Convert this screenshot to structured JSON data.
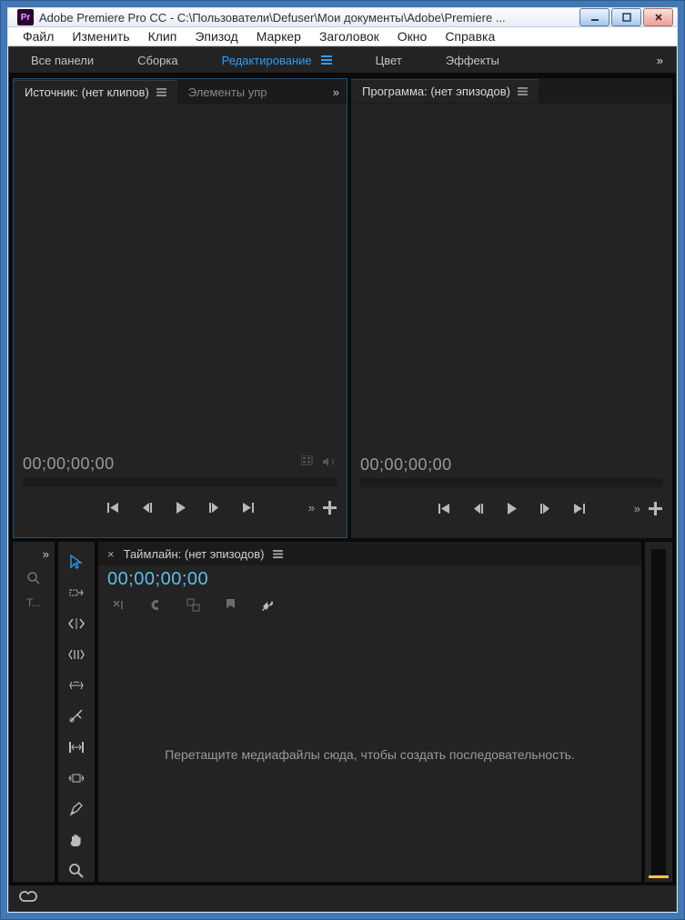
{
  "titlebar": {
    "app_badge": "Pr",
    "title": "Adobe Premiere Pro CC - C:\\Пользователи\\Defuser\\Мои документы\\Adobe\\Premiere ..."
  },
  "menu": {
    "items": [
      "Файл",
      "Изменить",
      "Клип",
      "Эпизод",
      "Маркер",
      "Заголовок",
      "Окно",
      "Справка"
    ]
  },
  "workspaces": {
    "items": [
      "Все панели",
      "Сборка",
      "Редактирование",
      "Цвет",
      "Эффекты"
    ],
    "active_index": 2,
    "overflow_glyph": "»"
  },
  "source_panel": {
    "tab_active": "Источник: (нет клипов)",
    "tab_inactive": "Элементы упр",
    "timecode": "00;00;00;00"
  },
  "program_panel": {
    "tab_active": "Программа: (нет эпизодов)",
    "timecode": "00;00;00;00"
  },
  "project_mini": {
    "label_t": "Т..."
  },
  "timeline": {
    "tab": "Таймлайн: (нет эпизодов)",
    "timecode": "00;00;00;00",
    "empty_hint": "Перетащите медиафайлы сюда, чтобы создать последовательность."
  }
}
